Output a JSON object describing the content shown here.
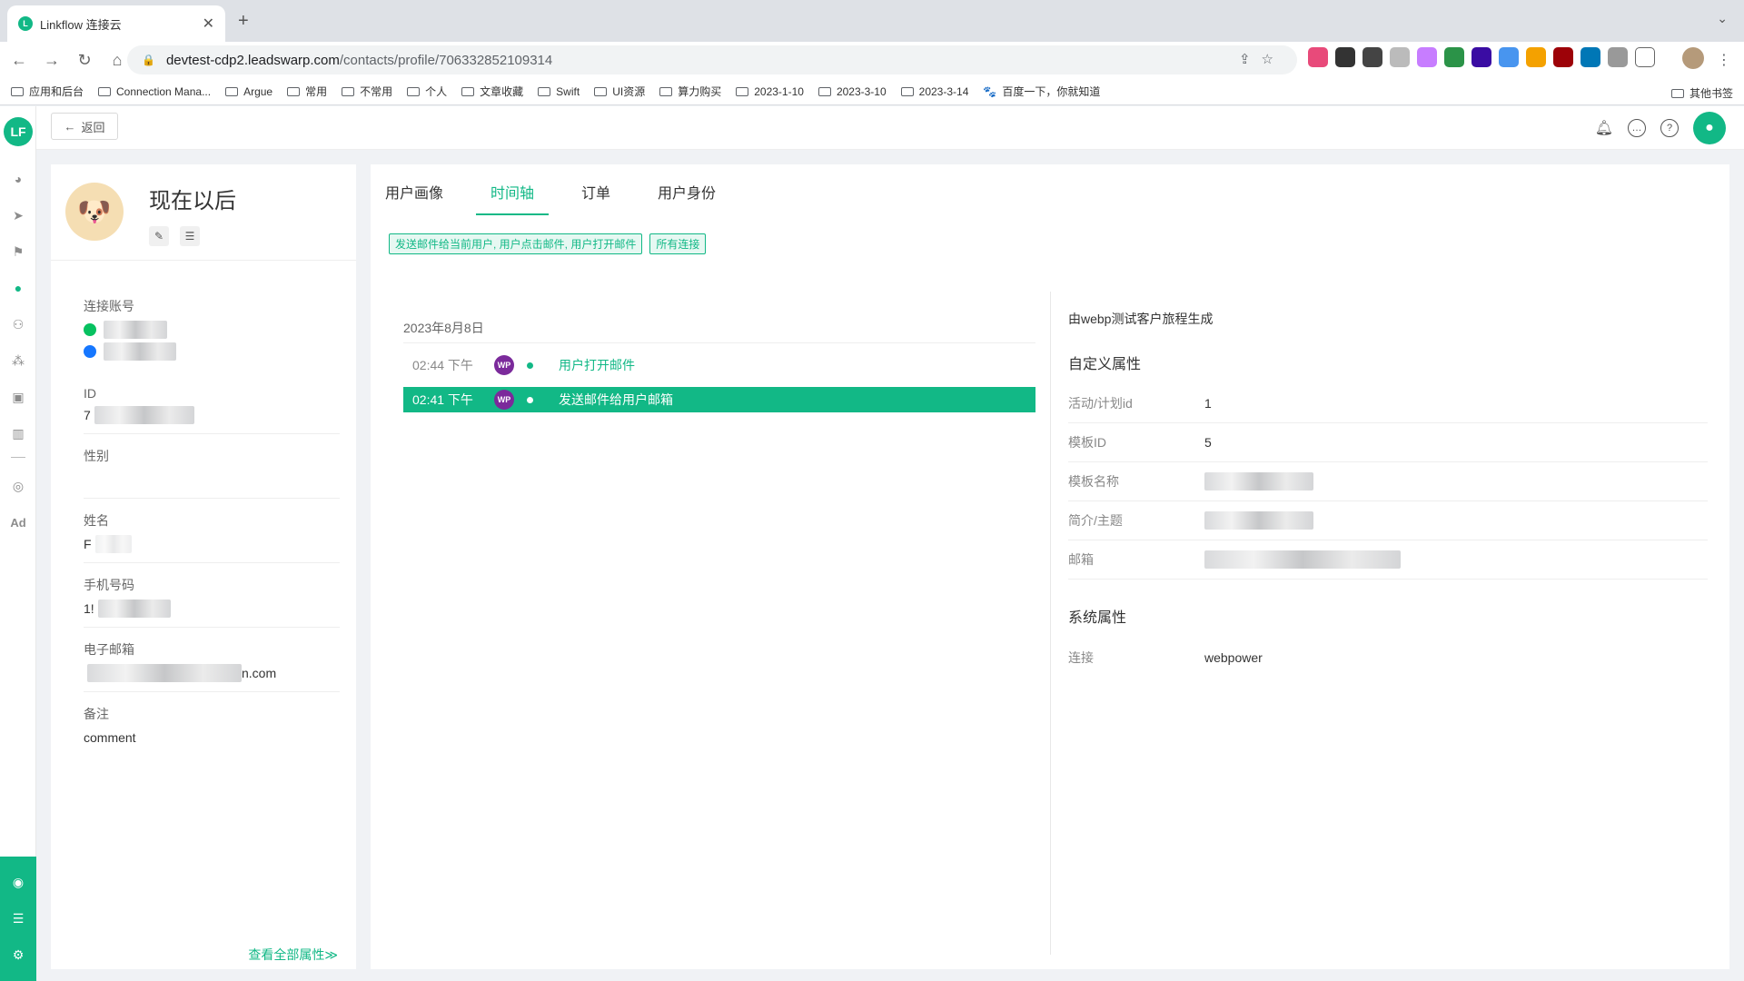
{
  "browser": {
    "tab_title": "Linkflow 连接云",
    "url_host": "devtest-cdp2.leadswarp.com",
    "url_path": "/contacts/profile/706332852109314",
    "bookmarks": [
      "应用和后台",
      "Connection Mana...",
      "Argue",
      "常用",
      "不常用",
      "个人",
      "文章收藏",
      "Swift",
      "UI资源",
      "算力购买",
      "2023-1-10",
      "2023-3-10",
      "2023-3-14"
    ],
    "baidu_bookmark": "百度一下，你就知道",
    "other_bookmarks": "其他书签"
  },
  "topbar": {
    "back_label": "返回"
  },
  "profile": {
    "name": "现在以后",
    "attributes": {
      "account_label": "连接账号",
      "id_label": "ID",
      "id_prefix": "7",
      "gender_label": "性别",
      "name_label": "姓名",
      "name_prefix": "F",
      "phone_label": "手机号码",
      "phone_prefix": "1!",
      "email_label": "电子邮箱",
      "email_suffix": "n.com",
      "note_label": "备注",
      "note_value": "comment"
    },
    "see_all": "查看全部属性≫"
  },
  "main": {
    "tabs": [
      {
        "label": "用户画像",
        "active": false
      },
      {
        "label": "时间轴",
        "active": true
      },
      {
        "label": "订单",
        "active": false
      },
      {
        "label": "用户身份",
        "active": false
      }
    ],
    "filters": [
      "发送邮件给当前用户, 用户点击邮件, 用户打开邮件",
      "所有连接"
    ],
    "timeline": {
      "date": "2023年8月8日",
      "events": [
        {
          "time": "02:44 下午",
          "badge": "WP",
          "event": "用户打开邮件",
          "active": false
        },
        {
          "time": "02:41 下午",
          "badge": "WP",
          "event": "发送邮件给用户邮箱",
          "active": true
        }
      ]
    },
    "detail": {
      "note": "由webp测试客户旅程生成",
      "custom_title": "自定义属性",
      "custom_rows": [
        {
          "key": "活动/计划id",
          "value": "1"
        },
        {
          "key": "模板ID",
          "value": "5"
        },
        {
          "key": "模板名称",
          "value": ""
        },
        {
          "key": "简介/主题",
          "value": ""
        },
        {
          "key": "邮箱",
          "value": ""
        }
      ],
      "system_title": "系统属性",
      "system_rows": [
        {
          "key": "连接",
          "value": "webpower"
        }
      ]
    }
  },
  "colors": {
    "accent": "#12b886",
    "wp_badge": "#7b2a9b"
  }
}
